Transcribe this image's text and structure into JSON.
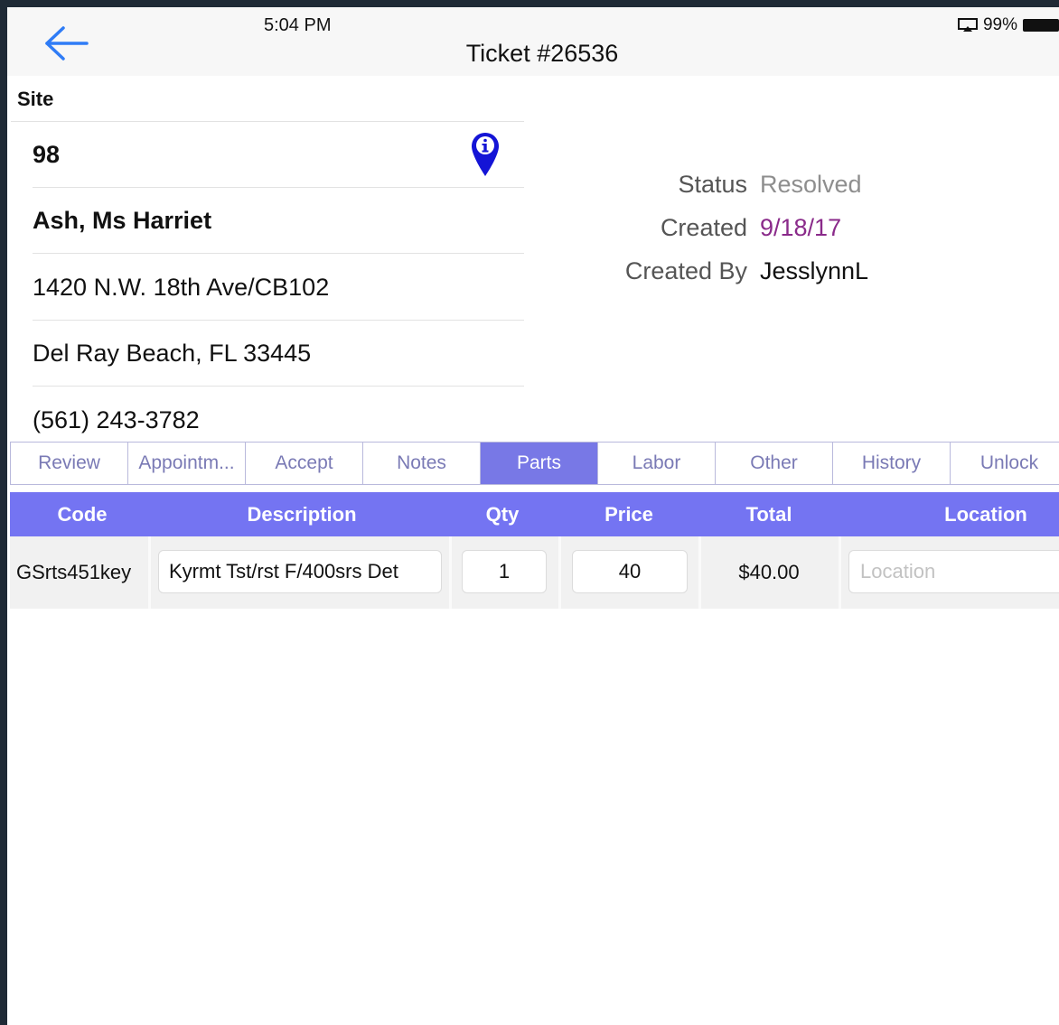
{
  "status_bar": {
    "time": "5:04 PM",
    "battery": "99%"
  },
  "nav": {
    "title": "Ticket #26536"
  },
  "site": {
    "label": "Site",
    "number": "98",
    "name": "Ash, Ms Harriet",
    "address": "1420 N.W. 18th Ave/CB102",
    "city": "Del Ray Beach, FL 33445",
    "phone": "(561) 243-3782"
  },
  "meta": {
    "status_label": "Status",
    "status_value": "Resolved",
    "created_label": "Created",
    "created_value": "9/18/17",
    "created_by_label": "Created By",
    "created_by_value": "JesslynnL"
  },
  "tabs": [
    {
      "label": "Review"
    },
    {
      "label": "Appointm..."
    },
    {
      "label": "Accept"
    },
    {
      "label": "Notes"
    },
    {
      "label": "Parts"
    },
    {
      "label": "Labor"
    },
    {
      "label": "Other"
    },
    {
      "label": "History"
    },
    {
      "label": "Unlock"
    }
  ],
  "active_tab": "Parts",
  "parts_table": {
    "headers": {
      "code": "Code",
      "description": "Description",
      "qty": "Qty",
      "price": "Price",
      "total": "Total",
      "location": "Location"
    },
    "rows": [
      {
        "code": "GSrts451key",
        "description": "Kyrmt Tst/rst F/400srs Det",
        "qty": "1",
        "price": "40",
        "total": "$40.00",
        "location": "",
        "location_placeholder": "Location"
      }
    ]
  },
  "colors": {
    "accent": "#7474f2",
    "active_tab": "#7878e6",
    "back_arrow": "#2f7cf6",
    "pin": "#1414d6",
    "created_date": "#8a2a8a"
  }
}
